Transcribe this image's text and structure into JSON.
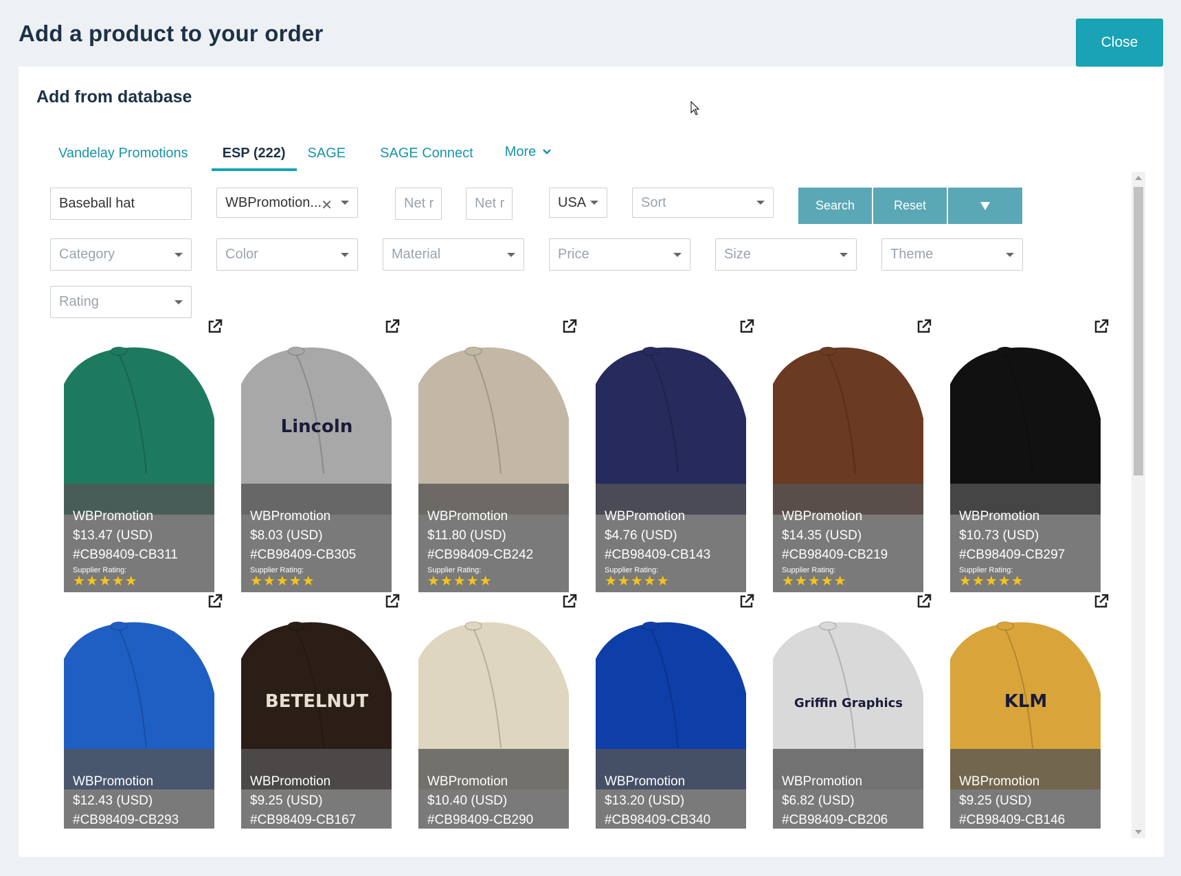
{
  "modal": {
    "title": "Add a product to your order",
    "close_label": "Close"
  },
  "panel": {
    "title": "Add from database"
  },
  "tabs": [
    {
      "label": "Vandelay Promotions",
      "active": false
    },
    {
      "label": "ESP (222)",
      "active": true
    },
    {
      "label": "SAGE",
      "active": false
    },
    {
      "label": "SAGE Connect",
      "active": false
    },
    {
      "label": "More",
      "active": false
    }
  ],
  "filters": {
    "keyword": "Baseball hat",
    "supplier": "WBPromotion...",
    "net_min_placeholder": "Net r",
    "net_max_placeholder": "Net r",
    "country": "USA",
    "sort_placeholder": "Sort",
    "search_label": "Search",
    "reset_label": "Reset",
    "category": "Category",
    "color": "Color",
    "material": "Material",
    "price": "Price",
    "size": "Size",
    "theme": "Theme",
    "rating": "Rating"
  },
  "colors": {
    "accent": "#19a3b4",
    "search_button": "#5aa7b6",
    "title": "#1d3147",
    "star": "#f5c518"
  },
  "products": [
    {
      "supplier": "WBPromotion",
      "price": "$13.47 (USD)",
      "sku": "#CB98409-CB311",
      "rating_label": "Supplier Rating:",
      "rating": 5,
      "hat_color": "#1e7a5f"
    },
    {
      "supplier": "WBPromotion",
      "price": "$8.03 (USD)",
      "sku": "#CB98409-CB305",
      "rating_label": "Supplier Rating:",
      "rating": 5,
      "hat_color": "#a8a8a8",
      "logo_text": "Lincoln"
    },
    {
      "supplier": "WBPromotion",
      "price": "$11.80 (USD)",
      "sku": "#CB98409-CB242",
      "rating_label": "Supplier Rating:",
      "rating": 5,
      "hat_color": "#c3b8a5"
    },
    {
      "supplier": "WBPromotion",
      "price": "$4.76 (USD)",
      "sku": "#CB98409-CB143",
      "rating_label": "Supplier Rating:",
      "rating": 5,
      "hat_color": "#262a5c"
    },
    {
      "supplier": "WBPromotion",
      "price": "$14.35 (USD)",
      "sku": "#CB98409-CB219",
      "rating_label": "Supplier Rating:",
      "rating": 5,
      "hat_color": "#6b3a22"
    },
    {
      "supplier": "WBPromotion",
      "price": "$10.73 (USD)",
      "sku": "#CB98409-CB297",
      "rating_label": "Supplier Rating:",
      "rating": 5,
      "hat_color": "#111111"
    },
    {
      "supplier": "WBPromotion",
      "price": "$12.43 (USD)",
      "sku": "#CB98409-CB293",
      "hat_color": "#1f5fc4"
    },
    {
      "supplier": "WBPromotion",
      "price": "$9.25 (USD)",
      "sku": "#CB98409-CB167",
      "hat_color": "#2b1e17",
      "logo_text": "BETELNUT"
    },
    {
      "supplier": "WBPromotion",
      "price": "$10.40 (USD)",
      "sku": "#CB98409-CB290",
      "hat_color": "#ded6bf"
    },
    {
      "supplier": "WBPromotion",
      "price": "$13.20 (USD)",
      "sku": "#CB98409-CB340",
      "hat_color": "#0e3fa8"
    },
    {
      "supplier": "WBPromotion",
      "price": "$6.82 (USD)",
      "sku": "#CB98409-CB206",
      "hat_color": "#d9d9d9",
      "logo_text": "Griffin Graphics"
    },
    {
      "supplier": "WBPromotion",
      "price": "$9.25 (USD)",
      "sku": "#CB98409-CB146",
      "hat_color": "#d9a53a",
      "logo_text": "KLM"
    }
  ]
}
